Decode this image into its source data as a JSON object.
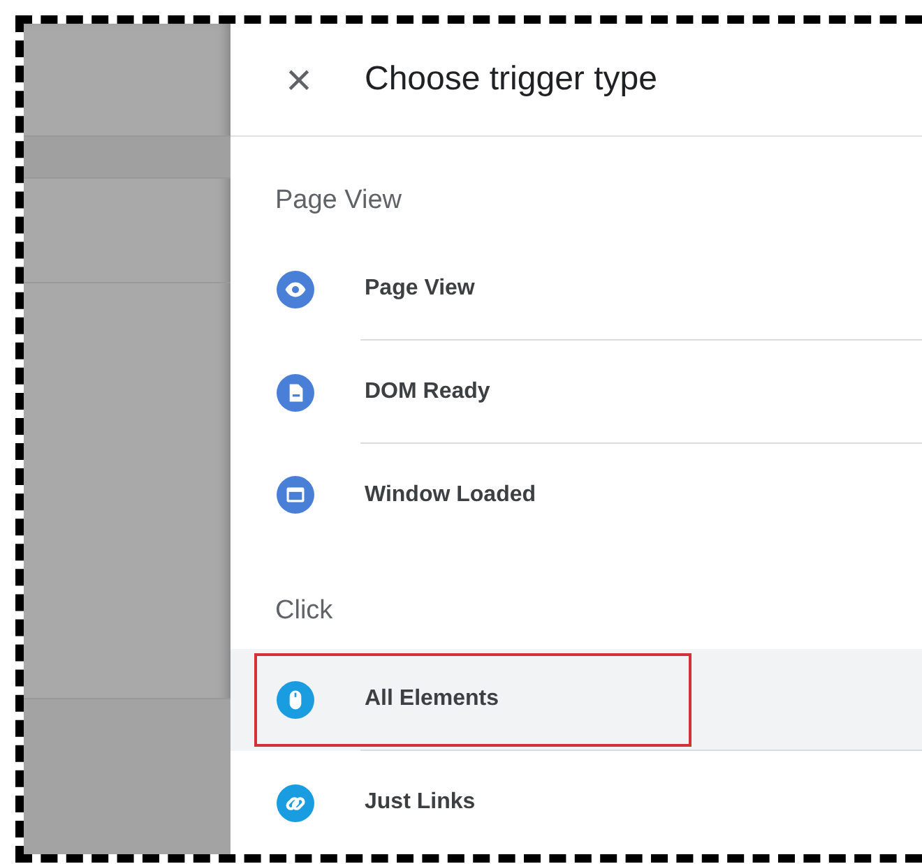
{
  "panel": {
    "close_icon": "×",
    "title": "Choose trigger type"
  },
  "sections": [
    {
      "label": "Page View",
      "items": [
        {
          "label": "Page View",
          "selected": false
        },
        {
          "label": "DOM Ready",
          "selected": false
        },
        {
          "label": "Window Loaded",
          "selected": false
        }
      ]
    },
    {
      "label": "Click",
      "items": [
        {
          "label": "All Elements",
          "selected": true
        },
        {
          "label": "Just Links",
          "selected": false
        }
      ]
    }
  ]
}
